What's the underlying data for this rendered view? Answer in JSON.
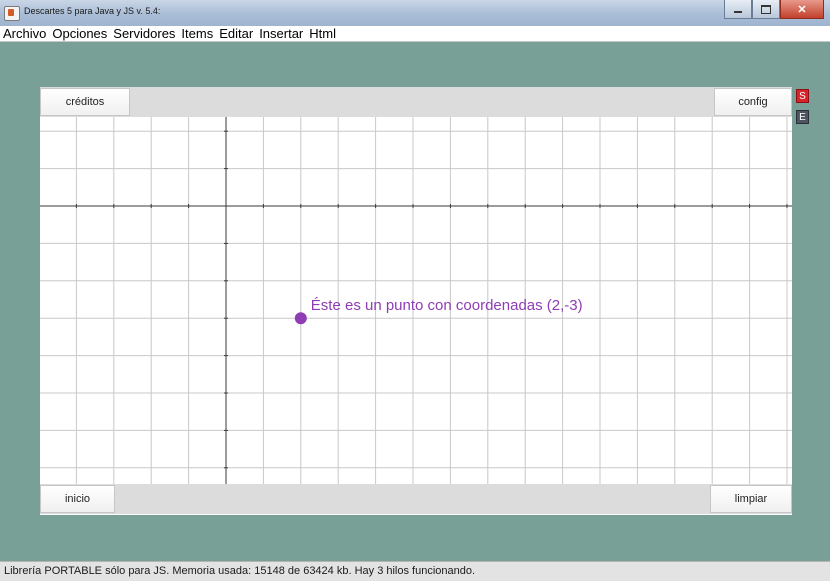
{
  "window": {
    "title": "Descartes 5 para Java y JS v. 5.4:"
  },
  "menu": {
    "items": [
      "Archivo",
      "Opciones",
      "Servidores",
      "Items",
      "Editar",
      "Insertar",
      "Html"
    ]
  },
  "scene": {
    "buttons": {
      "creditos": "créditos",
      "config": "config",
      "inicio": "inicio",
      "limpiar": "limpiar"
    },
    "point": {
      "x": 2,
      "y": -3,
      "label": "Éste es un punto con coordenadas (2,-3)",
      "color": "#8e3db5"
    },
    "grid": {
      "minor_color": "#c8c8c8",
      "axis_color": "#3a3a3a"
    }
  },
  "side": {
    "s_label": "S",
    "e_label": "E"
  },
  "status": {
    "text": "Librería PORTABLE sólo para JS. Memoria usada: 15148 de 63424 kb. Hay 3 hilos funcionando."
  },
  "colors": {
    "background": "#78a096",
    "menu_bg": "#ffffff",
    "status_bg": "#e3e3e3"
  }
}
